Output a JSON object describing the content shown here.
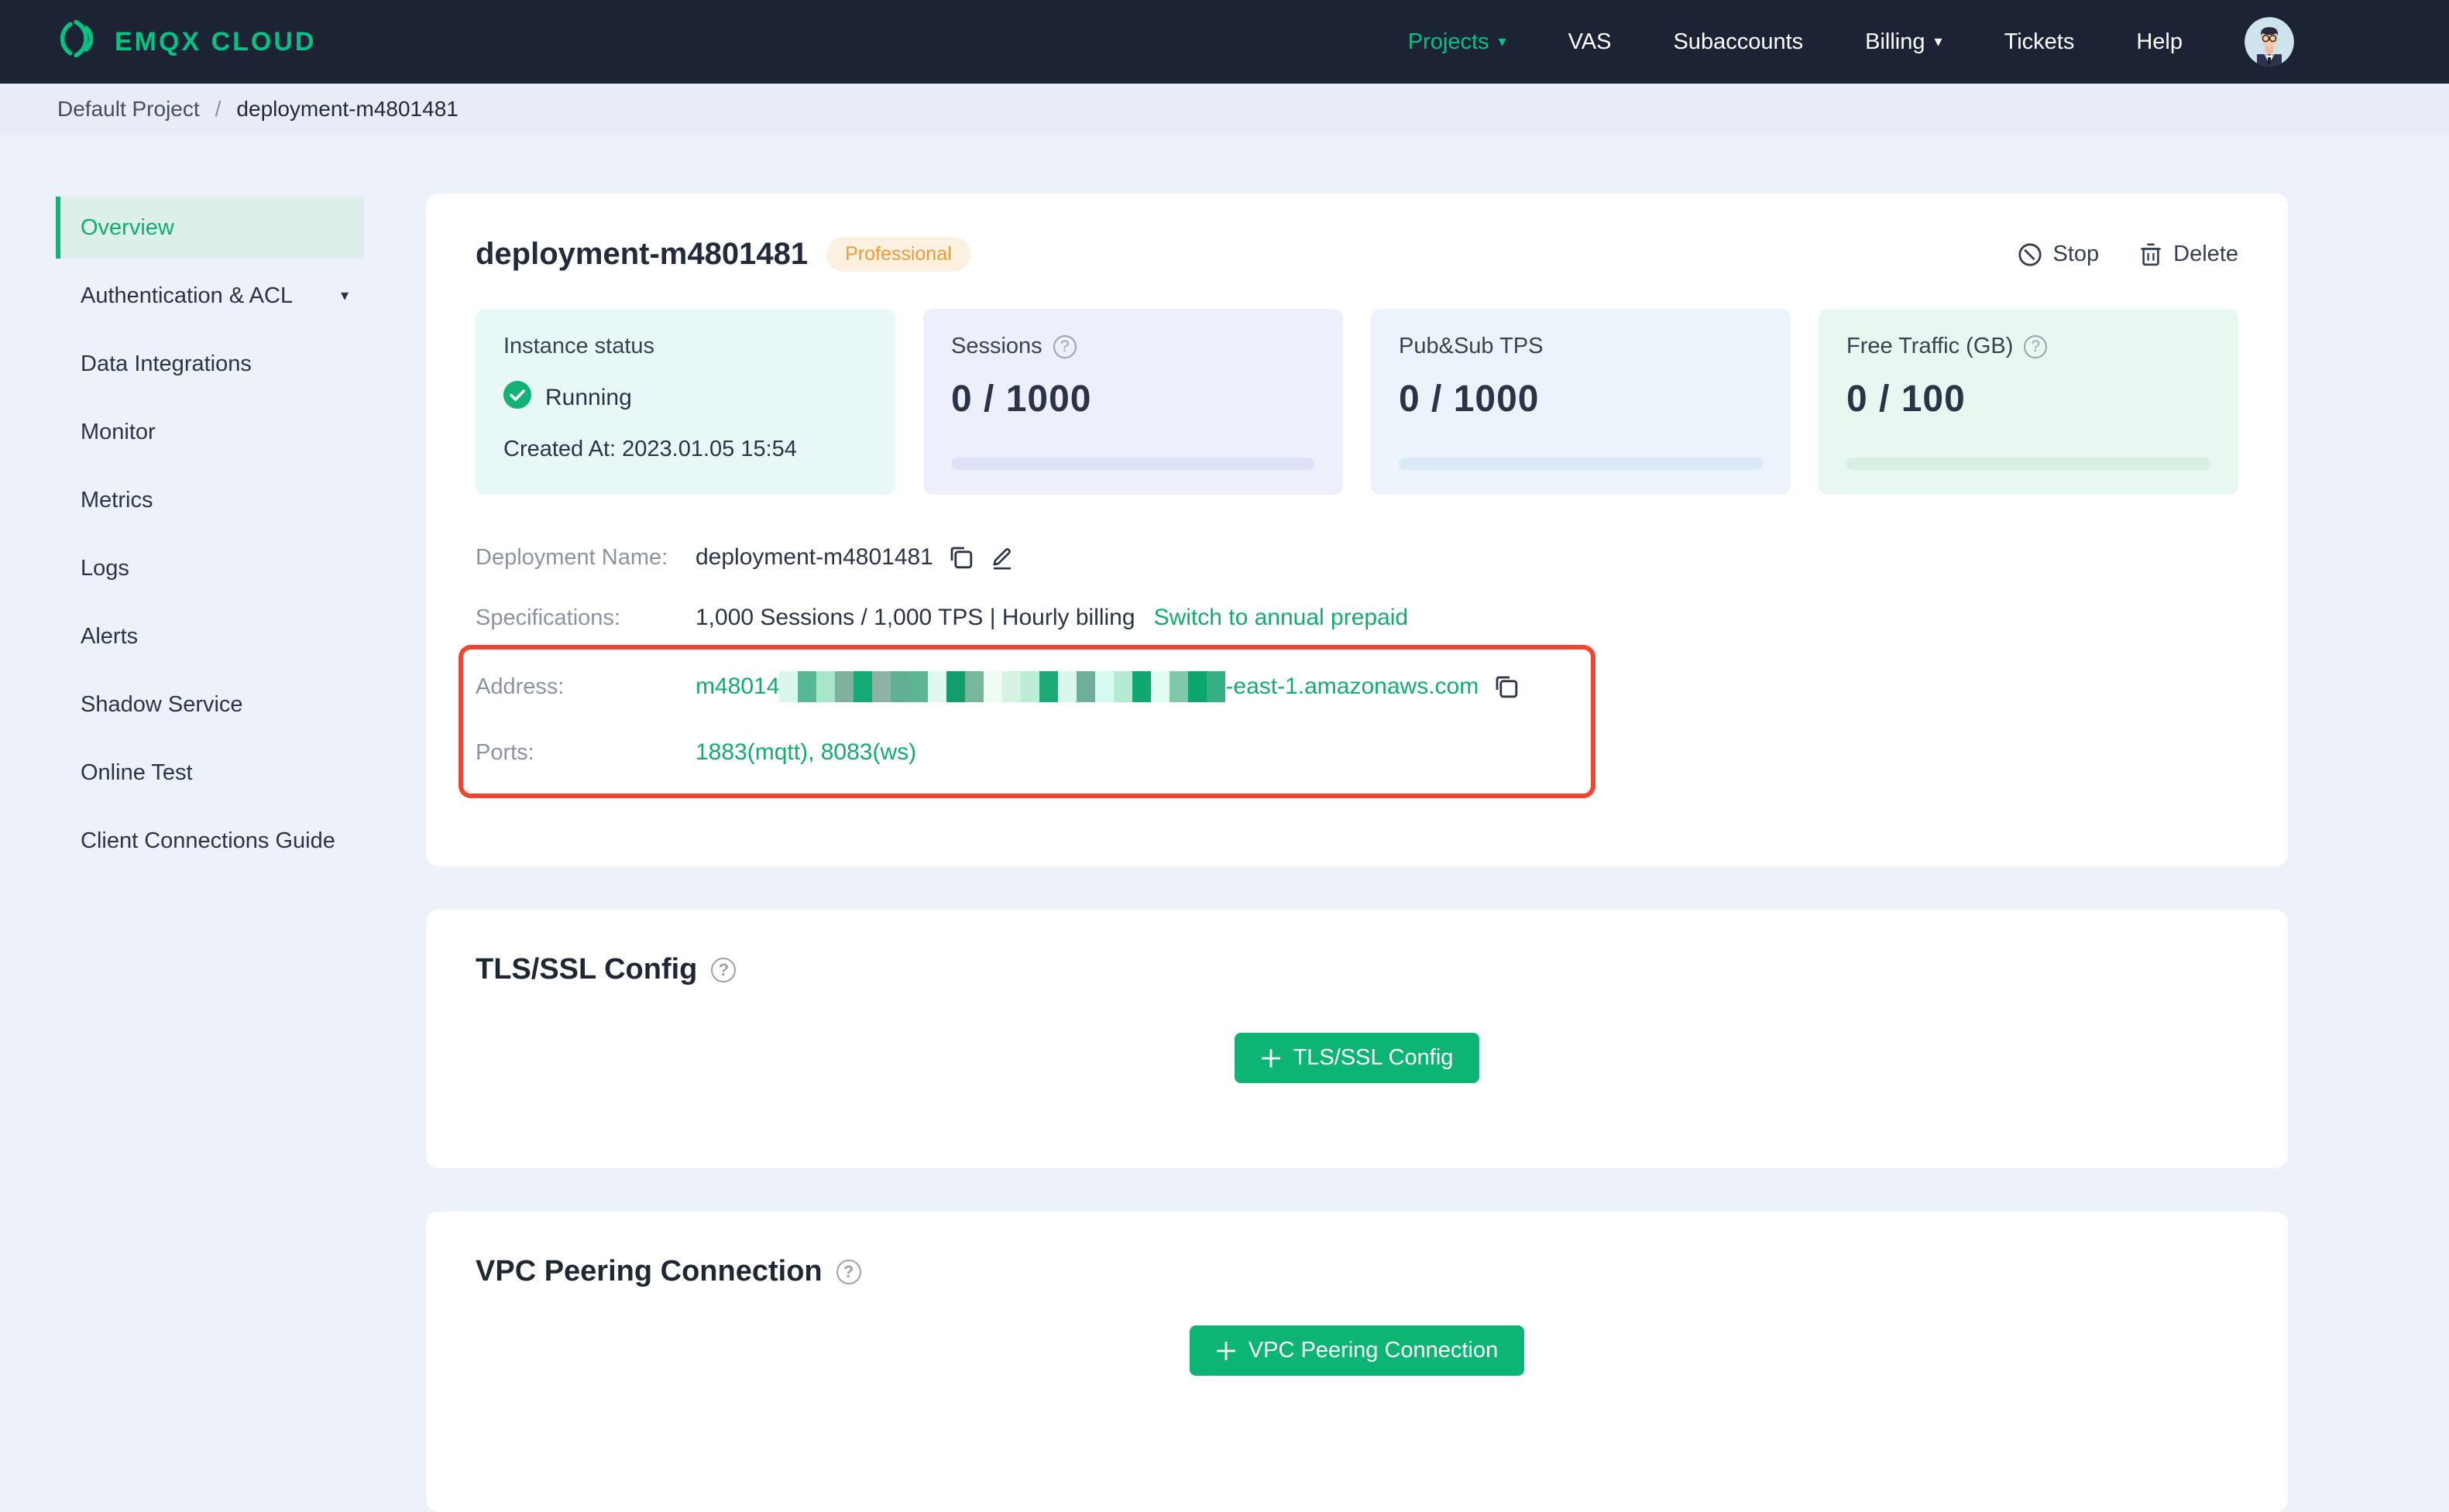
{
  "colors": {
    "navy": "#1c2334",
    "brand_green": "#00c482",
    "accent": "#0cb574",
    "link_green": "#0fae6d",
    "page_bg": "#edf1fa",
    "breadcrumb_bg": "#e9ecf6",
    "sidebar_active_bg": "#dcefe9",
    "badge_orange": "#f09a37",
    "badge_bg": "#fcf1e0",
    "red_box": "#f4432e",
    "card_status_bg": "#e7f8f6",
    "card_sessions_bg": "#edf0fb",
    "card_tps_bg": "#ecf3fa",
    "card_traffic_bg": "#e8f7f0",
    "bar_sessions": "#dde2f8",
    "bar_tps": "#d8eaf7",
    "bar_traffic": "#d7efe3",
    "text_dark": "#2b3447",
    "text_gray": "#8b93a3"
  },
  "icons": {
    "caret_down": "▾",
    "question": "?",
    "breadcrumb_separator": "/"
  },
  "nav": {
    "brand": "EMQX CLOUD",
    "items": [
      {
        "label": "Projects"
      },
      {
        "label": "VAS"
      },
      {
        "label": "Subaccounts"
      },
      {
        "label": "Billing"
      },
      {
        "label": "Tickets"
      },
      {
        "label": "Help"
      }
    ]
  },
  "breadcrumb": {
    "items": [
      "Default Project",
      "deployment-m4801481"
    ]
  },
  "sidebar": {
    "items": [
      {
        "label": "Overview"
      },
      {
        "label": "Authentication & ACL"
      },
      {
        "label": "Data Integrations"
      },
      {
        "label": "Monitor"
      },
      {
        "label": "Metrics"
      },
      {
        "label": "Logs"
      },
      {
        "label": "Alerts"
      },
      {
        "label": "Shadow Service"
      },
      {
        "label": "Online Test"
      },
      {
        "label": "Client Connections Guide"
      }
    ]
  },
  "overview": {
    "title": "deployment-m4801481",
    "plan_badge": "Professional",
    "actions": {
      "stop": "Stop",
      "delete": "Delete"
    },
    "status_card": {
      "label": "Instance status",
      "status": "Running",
      "created": "Created At: 2023.01.05 15:54"
    },
    "sessions_card": {
      "label": "Sessions",
      "value": "0 / 1000",
      "progress": 0
    },
    "tps_card": {
      "label": "Pub&Sub TPS",
      "value": "0 / 1000",
      "progress": 0
    },
    "traffic_card": {
      "label": "Free Traffic (GB)",
      "value": "0 / 100",
      "progress": 0
    },
    "details": {
      "deployment_name_label": "Deployment Name:",
      "deployment_name": "deployment-m4801481",
      "specifications_label": "Specifications:",
      "specifications": "1,000 Sessions / 1,000 TPS | Hourly billing",
      "switch_link": "Switch to annual prepaid",
      "address_label": "Address:",
      "address_prefix": "m48014",
      "address_suffix": "-east-1.amazonaws.com",
      "mosaic_colors": [
        "#d9f7eb",
        "#57b896",
        "#a8e6c9",
        "#7fb19f",
        "#13ab75",
        "#8cb3a6",
        "#62af94",
        "#5cb593",
        "#dff7ee",
        "#0f9e6c",
        "#77b79c",
        "#f0fbf6",
        "#d5f2e2",
        "#bceed5",
        "#1cab77",
        "#d9f7ea",
        "#6fae9a",
        "#d6fbee",
        "#b5ebd2",
        "#0fa871",
        "#e0fcf2",
        "#7fc9aa",
        "#0da56e",
        "#35b184"
      ],
      "ports_label": "Ports:",
      "ports": "1883(mqtt), 8083(ws)"
    }
  },
  "tls_section": {
    "title": "TLS/SSL Config",
    "button": "TLS/SSL Config"
  },
  "vpc_section": {
    "title": "VPC Peering Connection",
    "button": "VPC Peering Connection"
  }
}
